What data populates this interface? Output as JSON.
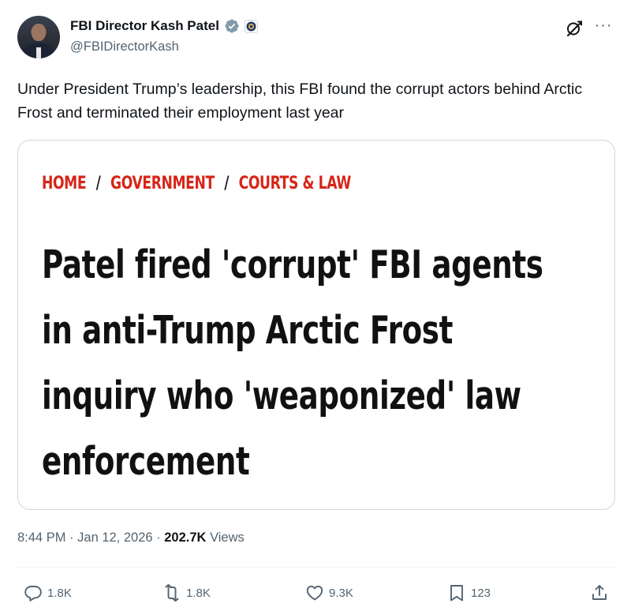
{
  "author": {
    "display_name": "FBI Director Kash Patel",
    "handle": "@FBIDirectorKash",
    "verified": true,
    "verified_color": "#1d9bf0"
  },
  "tweet": {
    "text": "Under President Trump’s leadership, this FBI found the corrupt actors behind Arctic Frost and terminated their employment last year"
  },
  "card": {
    "breadcrumb": [
      "HOME",
      "GOVERNMENT",
      "COURTS & LAW"
    ],
    "breadcrumb_separator": "/",
    "breadcrumb_color": "#d62518",
    "headline_lines": [
      "Patel fired 'corrupt' FBI agents",
      "in anti-Trump Arctic Frost",
      "inquiry who 'weaponized' law",
      "enforcement"
    ]
  },
  "meta": {
    "time": "8:44 PM",
    "date": "Jan 12, 2026",
    "separator": "·",
    "views_count": "202.7K",
    "views_label": "Views"
  },
  "actions": {
    "replies": "1.8K",
    "reposts": "1.8K",
    "likes": "9.3K",
    "bookmarks": "123"
  },
  "icons": {
    "grok": "grok-icon",
    "more": "more-icon",
    "reply": "reply-icon",
    "repost": "repost-icon",
    "like": "heart-icon",
    "bookmark": "bookmark-icon",
    "share": "share-icon"
  }
}
